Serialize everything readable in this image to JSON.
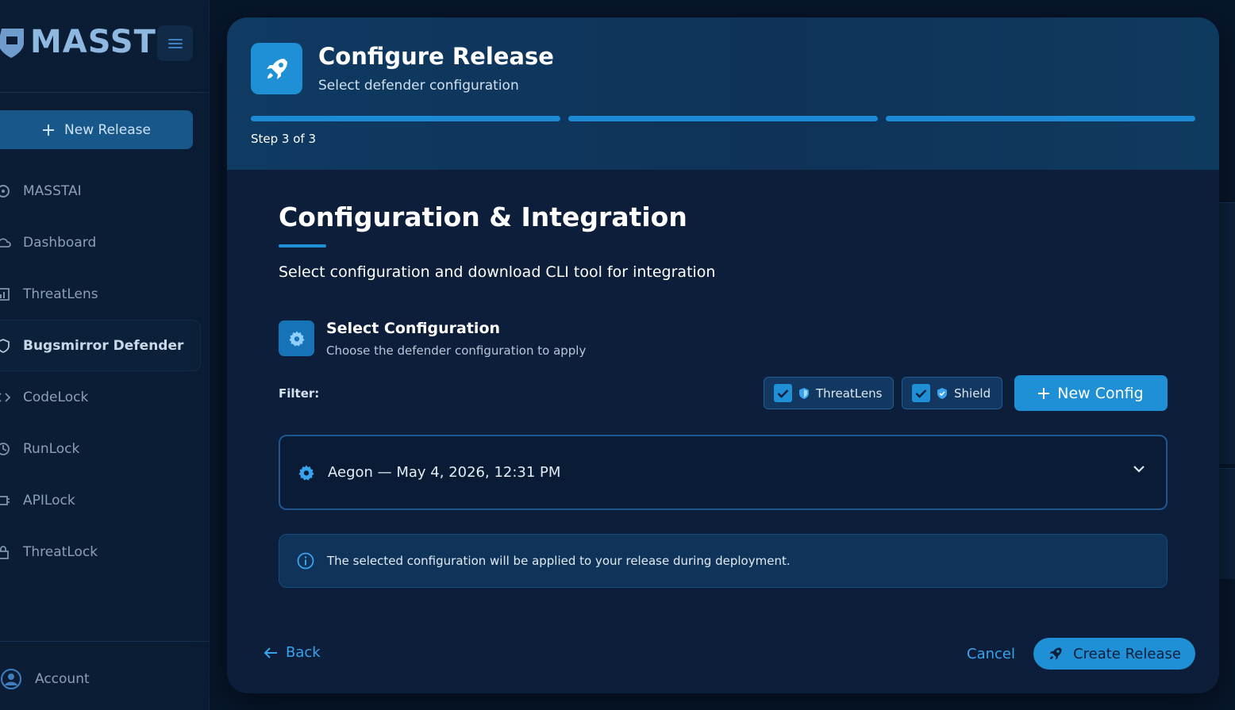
{
  "app": {
    "brand": "MASST",
    "new_release_label": "New Release",
    "nav": [
      {
        "label": "MASSTAI",
        "icon": "robot-icon"
      },
      {
        "label": "Dashboard",
        "icon": "cloud-icon"
      },
      {
        "label": "ThreatLens",
        "icon": "chart-icon"
      },
      {
        "label": "Bugsmirror Defender",
        "icon": "shield-icon",
        "active": true
      },
      {
        "label": "CodeLock",
        "icon": "code-icon"
      },
      {
        "label": "RunLock",
        "icon": "runtime-icon"
      },
      {
        "label": "APILock",
        "icon": "api-icon"
      },
      {
        "label": "ThreatLock",
        "icon": "lock-icon"
      }
    ],
    "account_label": "Account"
  },
  "modal": {
    "title": "Configure Release",
    "subtitle": "Select defender configuration",
    "step_label": "Step 3 of 3",
    "step_current": 3,
    "step_total": 3,
    "section_title": "Configuration & Integration",
    "section_desc": "Select configuration and download CLI tool for integration",
    "config": {
      "title": "Select Configuration",
      "subtitle": "Choose the defender configuration to apply"
    },
    "filter": {
      "label": "Filter:",
      "chips": [
        {
          "label": "ThreatLens",
          "checked": true
        },
        {
          "label": "Shield",
          "checked": true
        }
      ],
      "new_config_label": "New Config"
    },
    "selected_config": "Aegon — May 4, 2026, 12:31 PM",
    "info_text": "The selected configuration will be applied to your release during deployment.",
    "footer": {
      "back_label": "Back",
      "cancel_label": "Cancel",
      "create_label": "Create Release"
    }
  },
  "colors": {
    "accent": "#1f8fd6",
    "link": "#3aa3ee",
    "modal_bg": "#0c1e3a",
    "page_bg": "#07162b"
  }
}
